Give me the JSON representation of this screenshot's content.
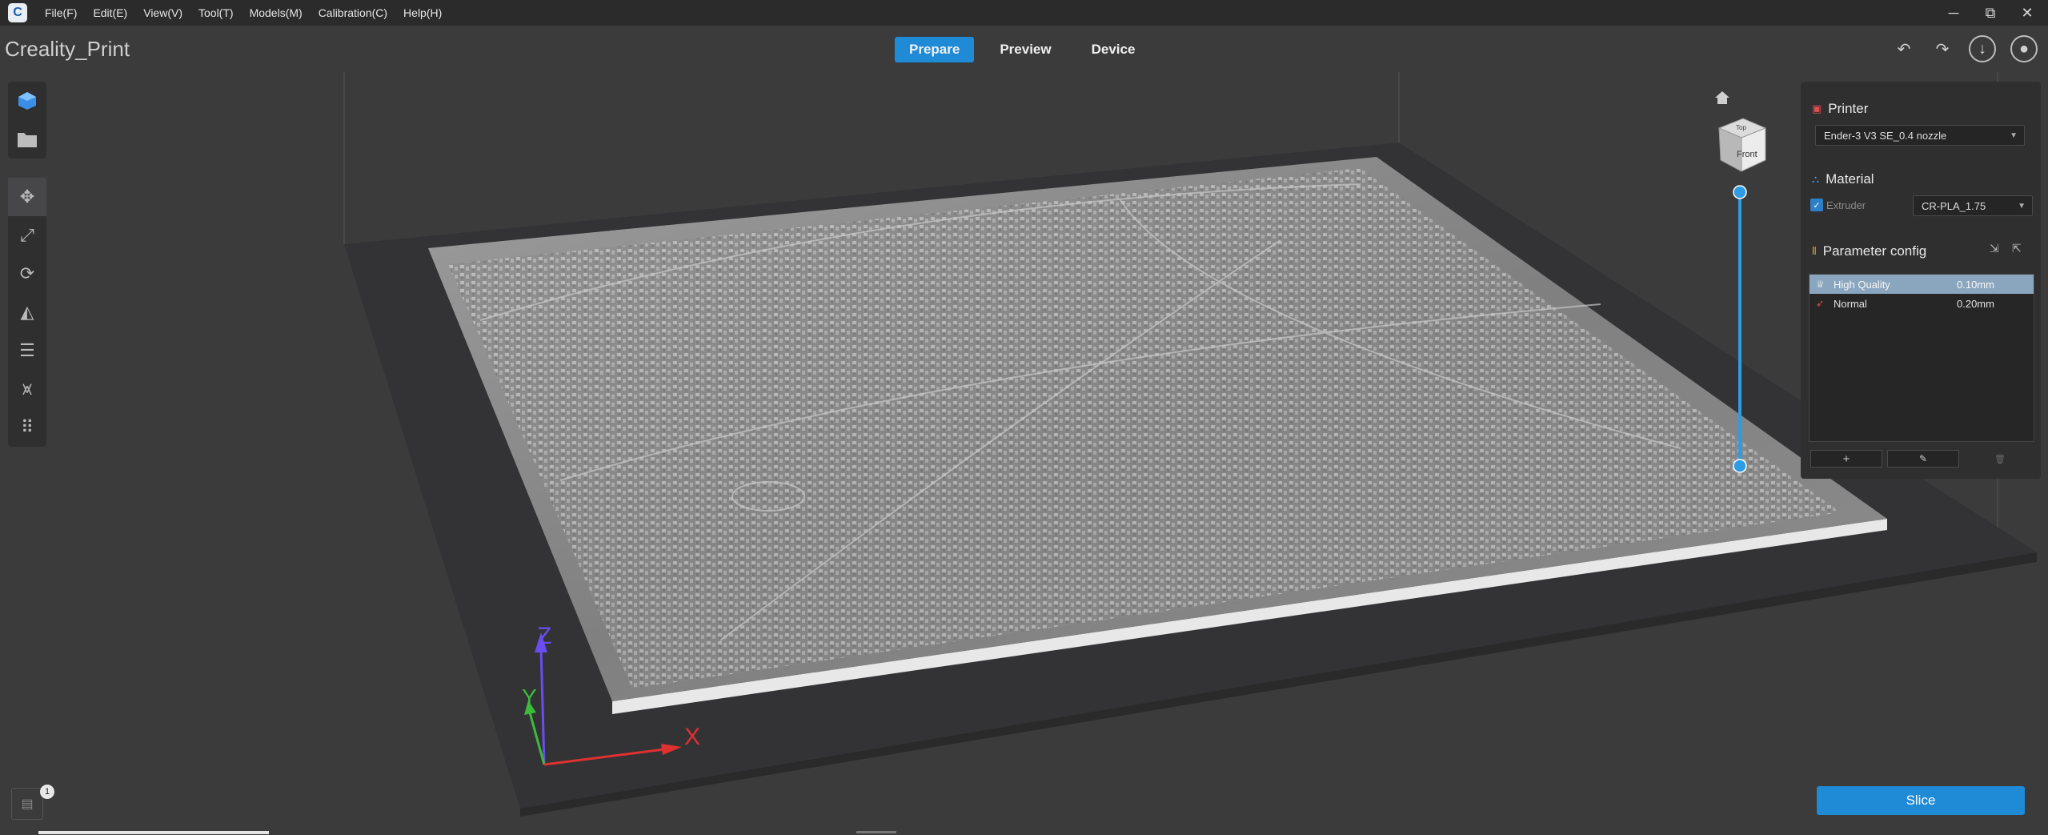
{
  "menu": {
    "app_icon": "C",
    "items": [
      "File(F)",
      "Edit(E)",
      "View(V)",
      "Tool(T)",
      "Models(M)",
      "Calibration(C)",
      "Help(H)"
    ]
  },
  "window_controls": {
    "minimize": "─",
    "restore": "⧉",
    "close": "✕"
  },
  "title": "Creality_Print",
  "tabs": [
    {
      "label": "Prepare",
      "active": true
    },
    {
      "label": "Preview",
      "active": false
    },
    {
      "label": "Device",
      "active": false
    }
  ],
  "top_right": {
    "undo": "↶",
    "redo": "↷",
    "download": "↓",
    "account": "●"
  },
  "left_toolbar": {
    "top_items": [
      "cube-add-icon",
      "open-folder-icon"
    ],
    "tools": [
      "move-icon",
      "scale-icon",
      "rotate-icon",
      "lay-flat-icon",
      "list-icon",
      "support-icon",
      "arrange-icon"
    ]
  },
  "view_cube": {
    "face_top": "Top",
    "face_front": "Front"
  },
  "axes": {
    "x": "X",
    "y": "Y",
    "z": "Z"
  },
  "right_panel": {
    "printer": {
      "title": "Printer",
      "selected": "Ender-3 V3 SE_0.4 nozzle"
    },
    "material": {
      "title": "Material",
      "extruder_label": "Extruder",
      "extruder_checked": true,
      "selected": "CR-PLA_1.75"
    },
    "params": {
      "title": "Parameter config",
      "rows": [
        {
          "name": "High Quality",
          "value": "0.10mm",
          "selected": true
        },
        {
          "name": "Normal",
          "value": "0.20mm",
          "selected": false
        }
      ],
      "add": "+",
      "edit": "✎",
      "delete": "🗑"
    }
  },
  "slice_label": "Slice",
  "bottom": {
    "badge": "1"
  },
  "colors": {
    "accent": "#1f8ad6",
    "bg": "#3b3b3c",
    "panel": "#2f2f30"
  }
}
